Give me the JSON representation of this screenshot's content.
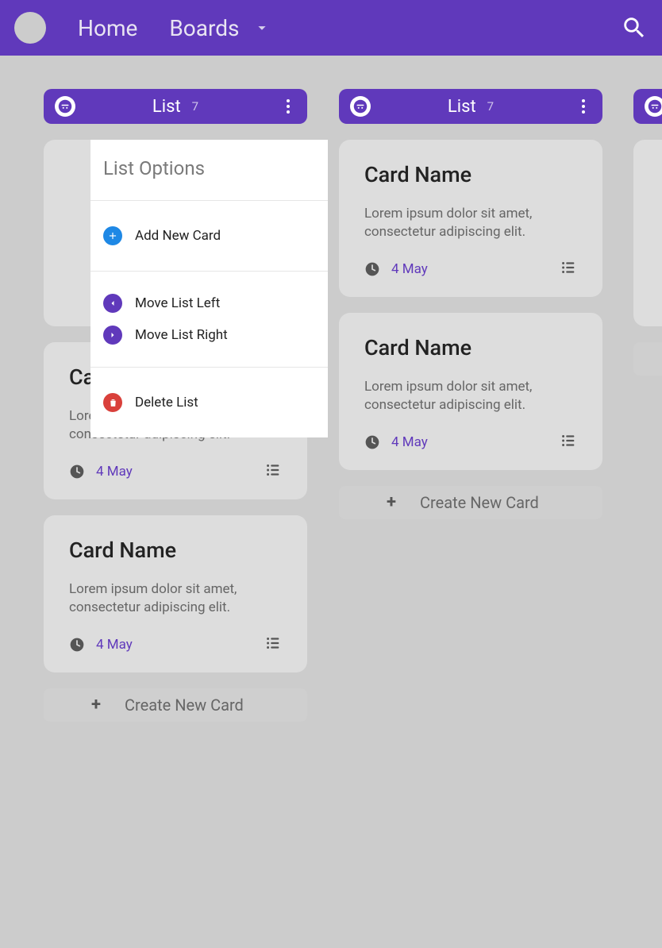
{
  "nav": {
    "home": "Home",
    "boards": "Boards"
  },
  "lists": [
    {
      "title": "List",
      "count": "7"
    },
    {
      "title": "List",
      "count": "7"
    }
  ],
  "cards": {
    "title": "Card Name",
    "desc": "Lorem ipsum dolor sit amet, consectetur adipiscing elit.",
    "date": "4 May"
  },
  "create_label": "Create New Card",
  "popover": {
    "title": "List Options",
    "add": "Add New Card",
    "move_left": "Move List Left",
    "move_right": "Move List Right",
    "delete": "Delete List"
  }
}
